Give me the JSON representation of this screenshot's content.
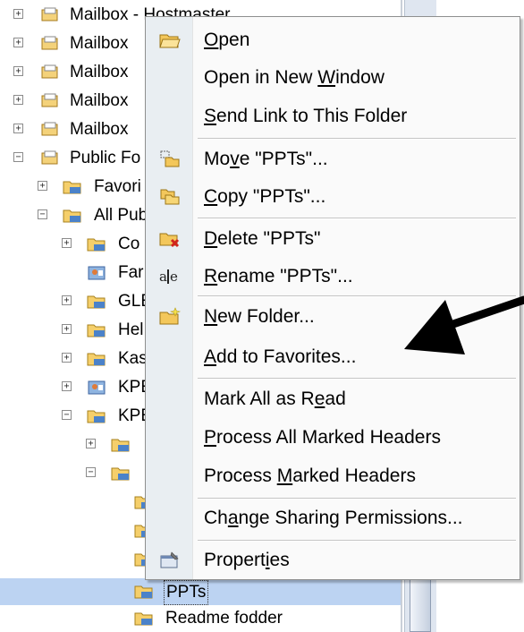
{
  "tree": {
    "rows": [
      {
        "label": "Mailbox - Hostmaster",
        "expander": "+",
        "icon": "mailbox"
      },
      {
        "label": "Mailbox",
        "expander": "+",
        "icon": "mailbox"
      },
      {
        "label": "Mailbox",
        "expander": "+",
        "icon": "mailbox"
      },
      {
        "label": "Mailbox",
        "expander": "+",
        "icon": "mailbox"
      },
      {
        "label": "Mailbox",
        "expander": "+",
        "icon": "mailbox"
      },
      {
        "label": "Public Fo",
        "expander": "−",
        "icon": "mailbox"
      },
      {
        "label": "Favori",
        "expander": "+",
        "icon": "folder"
      },
      {
        "label": "All Pub",
        "expander": "−",
        "icon": "folder"
      },
      {
        "label": "Co",
        "expander": "+",
        "icon": "folder"
      },
      {
        "label": "Far",
        "expander": "",
        "icon": "contacts"
      },
      {
        "label": "GLE",
        "expander": "+",
        "icon": "folder"
      },
      {
        "label": "Hel",
        "expander": "+",
        "icon": "folder"
      },
      {
        "label": "Kas",
        "expander": "+",
        "icon": "folder"
      },
      {
        "label": "KPE",
        "expander": "+",
        "icon": "contacts"
      },
      {
        "label": "KPE",
        "expander": "−",
        "icon": "folder"
      },
      {
        "label": "",
        "expander": "+",
        "icon": "folder"
      },
      {
        "label": "",
        "expander": "−",
        "icon": "folder"
      },
      {
        "label": "",
        "expander": "",
        "icon": "folder"
      },
      {
        "label": "",
        "expander": "",
        "icon": "folder"
      },
      {
        "label": "",
        "expander": "",
        "icon": "folder"
      },
      {
        "label": "PPTs",
        "expander": "",
        "icon": "folder"
      },
      {
        "label": "Readme fodder",
        "expander": "",
        "icon": "folder"
      }
    ]
  },
  "menu": {
    "items": [
      {
        "label": "Open",
        "key": "O",
        "icon": "open-folder-icon"
      },
      {
        "label": "Open in New Window",
        "key": "W",
        "icon": ""
      },
      {
        "label": "Send Link to This Folder",
        "key": "S",
        "icon": ""
      },
      {
        "label": "Move \"PPTs\"...",
        "key": "v",
        "icon": "move-folder-icon"
      },
      {
        "label": "Copy \"PPTs\"...",
        "key": "C",
        "icon": "copy-folder-icon"
      },
      {
        "label": "Delete \"PPTs\"",
        "key": "D",
        "icon": "delete-folder-icon"
      },
      {
        "label": "Rename \"PPTs\"...",
        "key": "R",
        "icon": "rename-icon"
      },
      {
        "label": "New Folder...",
        "key": "N",
        "icon": "new-folder-icon"
      },
      {
        "label": "Add to Favorites...",
        "key": "A",
        "icon": ""
      },
      {
        "label": "Mark All as Read",
        "key": "e",
        "icon": ""
      },
      {
        "label": "Process All Marked Headers",
        "key": "P",
        "icon": ""
      },
      {
        "label": "Process Marked Headers",
        "key": "M",
        "icon": ""
      },
      {
        "label": "Change Sharing Permissions...",
        "key": "a",
        "icon": ""
      },
      {
        "label": "Properties",
        "key": "i",
        "icon": "properties-icon"
      }
    ]
  },
  "colors": {
    "selection": "#bcd3f2",
    "menu_gutter": "#e9eef2",
    "arrow": "#000000"
  }
}
